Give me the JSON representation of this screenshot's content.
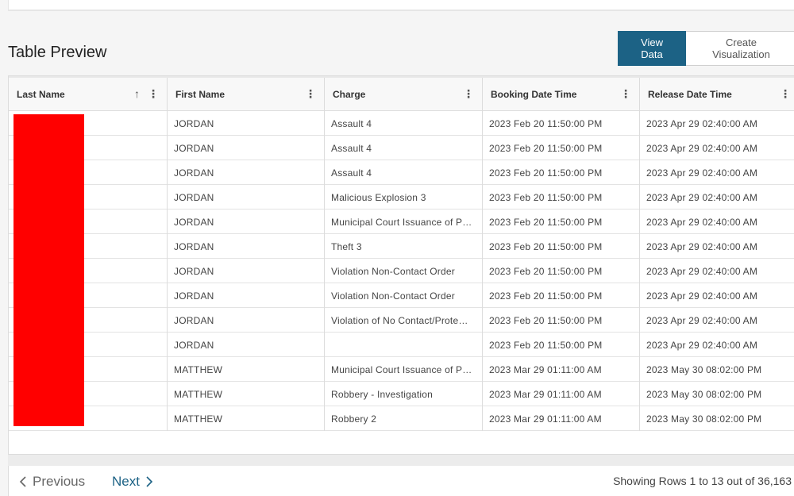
{
  "section_title": "Table Preview",
  "view_toggle": {
    "view_data_label": "View Data",
    "create_visualization_label": "Create Visualization"
  },
  "table": {
    "columns": [
      {
        "label": "Last Name",
        "sorted": "ascending"
      },
      {
        "label": "First Name"
      },
      {
        "label": "Charge"
      },
      {
        "label": "Booking Date Time"
      },
      {
        "label": "Release Date Time"
      }
    ],
    "rows": [
      {
        "last_name": "",
        "first_name": "JORDAN",
        "charge": "Assault 4",
        "booking": "2023 Feb 20 11:50:00 PM",
        "release": "2023 Apr 29 02:40:00 AM"
      },
      {
        "last_name": "",
        "first_name": "JORDAN",
        "charge": "Assault 4",
        "booking": "2023 Feb 20 11:50:00 PM",
        "release": "2023 Apr 29 02:40:00 AM"
      },
      {
        "last_name": "",
        "first_name": "JORDAN",
        "charge": "Assault 4",
        "booking": "2023 Feb 20 11:50:00 PM",
        "release": "2023 Apr 29 02:40:00 AM"
      },
      {
        "last_name": "",
        "first_name": "JORDAN",
        "charge": "Malicious Explosion 3",
        "booking": "2023 Feb 20 11:50:00 PM",
        "release": "2023 Apr 29 02:40:00 AM"
      },
      {
        "last_name": "",
        "first_name": "JORDAN",
        "charge": "Municipal Court Issuance of P…",
        "booking": "2023 Feb 20 11:50:00 PM",
        "release": "2023 Apr 29 02:40:00 AM"
      },
      {
        "last_name": "",
        "first_name": "JORDAN",
        "charge": "Theft 3",
        "booking": "2023 Feb 20 11:50:00 PM",
        "release": "2023 Apr 29 02:40:00 AM"
      },
      {
        "last_name": "",
        "first_name": "JORDAN",
        "charge": "Violation Non-Contact Order",
        "booking": "2023 Feb 20 11:50:00 PM",
        "release": "2023 Apr 29 02:40:00 AM"
      },
      {
        "last_name": "",
        "first_name": "JORDAN",
        "charge": "Violation Non-Contact Order",
        "booking": "2023 Feb 20 11:50:00 PM",
        "release": "2023 Apr 29 02:40:00 AM"
      },
      {
        "last_name": "",
        "first_name": "JORDAN",
        "charge": "Violation of No Contact/Prote…",
        "booking": "2023 Feb 20 11:50:00 PM",
        "release": "2023 Apr 29 02:40:00 AM"
      },
      {
        "last_name": "",
        "first_name": "JORDAN",
        "charge": "",
        "booking": "2023 Feb 20 11:50:00 PM",
        "release": "2023 Apr 29 02:40:00 AM"
      },
      {
        "last_name": "",
        "first_name": "MATTHEW",
        "charge": "Municipal Court Issuance of P…",
        "booking": "2023 Mar 29 01:11:00 AM",
        "release": "2023 May 30 08:02:00 PM"
      },
      {
        "last_name": "",
        "first_name": "MATTHEW",
        "charge": "Robbery - Investigation",
        "booking": "2023 Mar 29 01:11:00 AM",
        "release": "2023 May 30 08:02:00 PM"
      },
      {
        "last_name": "",
        "first_name": "MATTHEW",
        "charge": "Robbery 2",
        "booking": "2023 Mar 29 01:11:00 AM",
        "release": "2023 May 30 08:02:00 PM"
      }
    ]
  },
  "pager": {
    "previous_label": "Previous",
    "next_label": "Next",
    "rows_info": "Showing Rows 1 to 13 out of 36,163"
  },
  "colors": {
    "accent": "#1c6285",
    "redaction": "#ff0000"
  },
  "icons": {
    "sort": "arrow-up-icon",
    "column_menu": "kebab-menu-icon",
    "previous": "chevron-left-icon",
    "next": "chevron-right-icon"
  }
}
